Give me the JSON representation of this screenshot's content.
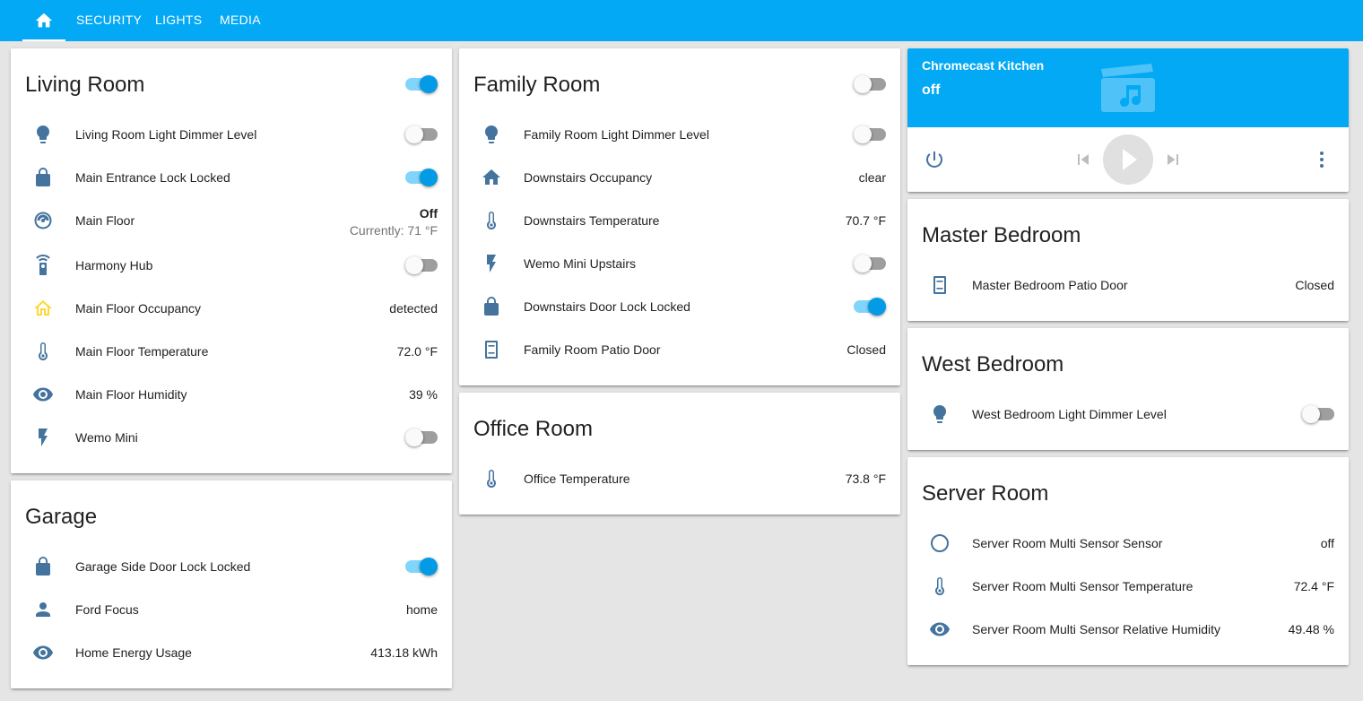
{
  "nav": {
    "home_icon": "home-icon",
    "tabs": [
      "SECURITY",
      "LIGHTS",
      "MEDIA"
    ]
  },
  "colors": {
    "header": "#03a9f4",
    "icon": "#44739e",
    "toggle_on": "#039be5",
    "occupancy_detected": "#fdd835"
  },
  "living_room": {
    "title": "Living Room",
    "toggle_on": true,
    "light": {
      "label": "Living Room Light Dimmer Level",
      "on": false,
      "icon": "lightbulb-icon"
    },
    "lock": {
      "label": "Main Entrance Lock Locked",
      "on": true,
      "icon": "lock-icon"
    },
    "thermostat": {
      "label": "Main Floor",
      "state": "Off",
      "current": "Currently: 71 °F",
      "icon": "thermostat-icon"
    },
    "harmony": {
      "label": "Harmony Hub",
      "on": false,
      "icon": "remote-icon"
    },
    "occupancy": {
      "label": "Main Floor Occupancy",
      "value": "detected",
      "icon": "home-outline-icon"
    },
    "temperature": {
      "label": "Main Floor Temperature",
      "value": "72.0 °F",
      "icon": "thermometer-icon"
    },
    "humidity": {
      "label": "Main Floor Humidity",
      "value": "39 %",
      "icon": "eye-icon"
    },
    "wemo": {
      "label": "Wemo Mini",
      "on": false,
      "icon": "flash-icon"
    }
  },
  "garage": {
    "title": "Garage",
    "lock": {
      "label": "Garage Side Door Lock Locked",
      "on": true,
      "icon": "lock-icon"
    },
    "car": {
      "label": "Ford Focus",
      "value": "home",
      "icon": "account-icon"
    },
    "energy": {
      "label": "Home Energy Usage",
      "value": "413.18 kWh",
      "icon": "eye-icon"
    }
  },
  "family_room": {
    "title": "Family Room",
    "toggle_on": false,
    "light": {
      "label": "Family Room Light Dimmer Level",
      "on": false,
      "icon": "lightbulb-icon"
    },
    "occupancy": {
      "label": "Downstairs Occupancy",
      "value": "clear",
      "icon": "home-icon"
    },
    "temperature": {
      "label": "Downstairs Temperature",
      "value": "70.7 °F",
      "icon": "thermometer-icon"
    },
    "wemo": {
      "label": "Wemo Mini Upstairs",
      "on": false,
      "icon": "flash-icon"
    },
    "lock": {
      "label": "Downstairs Door Lock Locked",
      "on": true,
      "icon": "lock-icon"
    },
    "door": {
      "label": "Family Room Patio Door",
      "value": "Closed",
      "icon": "door-closed-icon"
    }
  },
  "office_room": {
    "title": "Office Room",
    "temperature": {
      "label": "Office Temperature",
      "value": "73.8 °F",
      "icon": "thermometer-icon"
    }
  },
  "media_player": {
    "name": "Chromecast Kitchen",
    "state": "off",
    "art_icon": "movie-music-icon"
  },
  "master_bedroom": {
    "title": "Master Bedroom",
    "door": {
      "label": "Master Bedroom Patio Door",
      "value": "Closed",
      "icon": "door-closed-icon"
    }
  },
  "west_bedroom": {
    "title": "West Bedroom",
    "light": {
      "label": "West Bedroom Light Dimmer Level",
      "on": false,
      "icon": "lightbulb-icon"
    }
  },
  "server_room": {
    "title": "Server Room",
    "sensor": {
      "label": "Server Room Multi Sensor Sensor",
      "value": "off",
      "icon": "circle-outline-icon"
    },
    "temperature": {
      "label": "Server Room Multi Sensor Temperature",
      "value": "72.4 °F",
      "icon": "thermometer-icon"
    },
    "humidity": {
      "label": "Server Room Multi Sensor Relative Humidity",
      "value": "49.48 %",
      "icon": "eye-icon"
    }
  }
}
